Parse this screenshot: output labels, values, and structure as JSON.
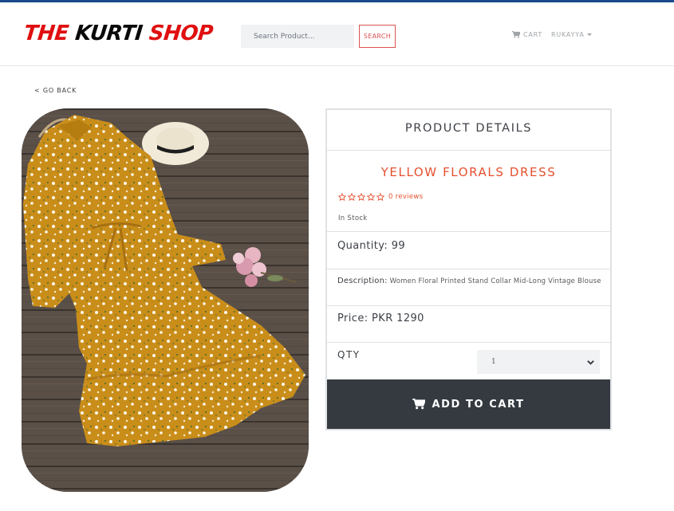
{
  "brand": {
    "part1": "THE ",
    "part2": "KURTI",
    "part3": " SHOP"
  },
  "search": {
    "placeholder": "Search Product...",
    "button_label": "SEARCH"
  },
  "nav": {
    "cart_label": "CART",
    "user_label": "RUKAYYA"
  },
  "go_back": "< GO BACK",
  "panel": {
    "title": "PRODUCT DETAILS",
    "product_name": "YELLOW FLORALS DRESS",
    "rating": 0,
    "max_rating": 5,
    "reviews": "0 reviews",
    "stock": "In Stock",
    "quantity": "Quantity: 99",
    "description_label": "Description:",
    "description": "Women Floral Printed Stand Collar Mid-Long Vintage Blouse",
    "price": "Price: PKR 1290",
    "qty_label": "QTY",
    "qty_value": "1",
    "add_to_cart": "ADD TO CART"
  },
  "colors": {
    "accent": "#e4502f",
    "brand_red": "#e01010",
    "dark_button": "#343a40",
    "top_border": "#1a4a8c",
    "dress": "#c98d1a",
    "wood": "#5c5147"
  },
  "image": {
    "alt": "Yellow floral dress on wooden floor with hat and pink flowers"
  }
}
